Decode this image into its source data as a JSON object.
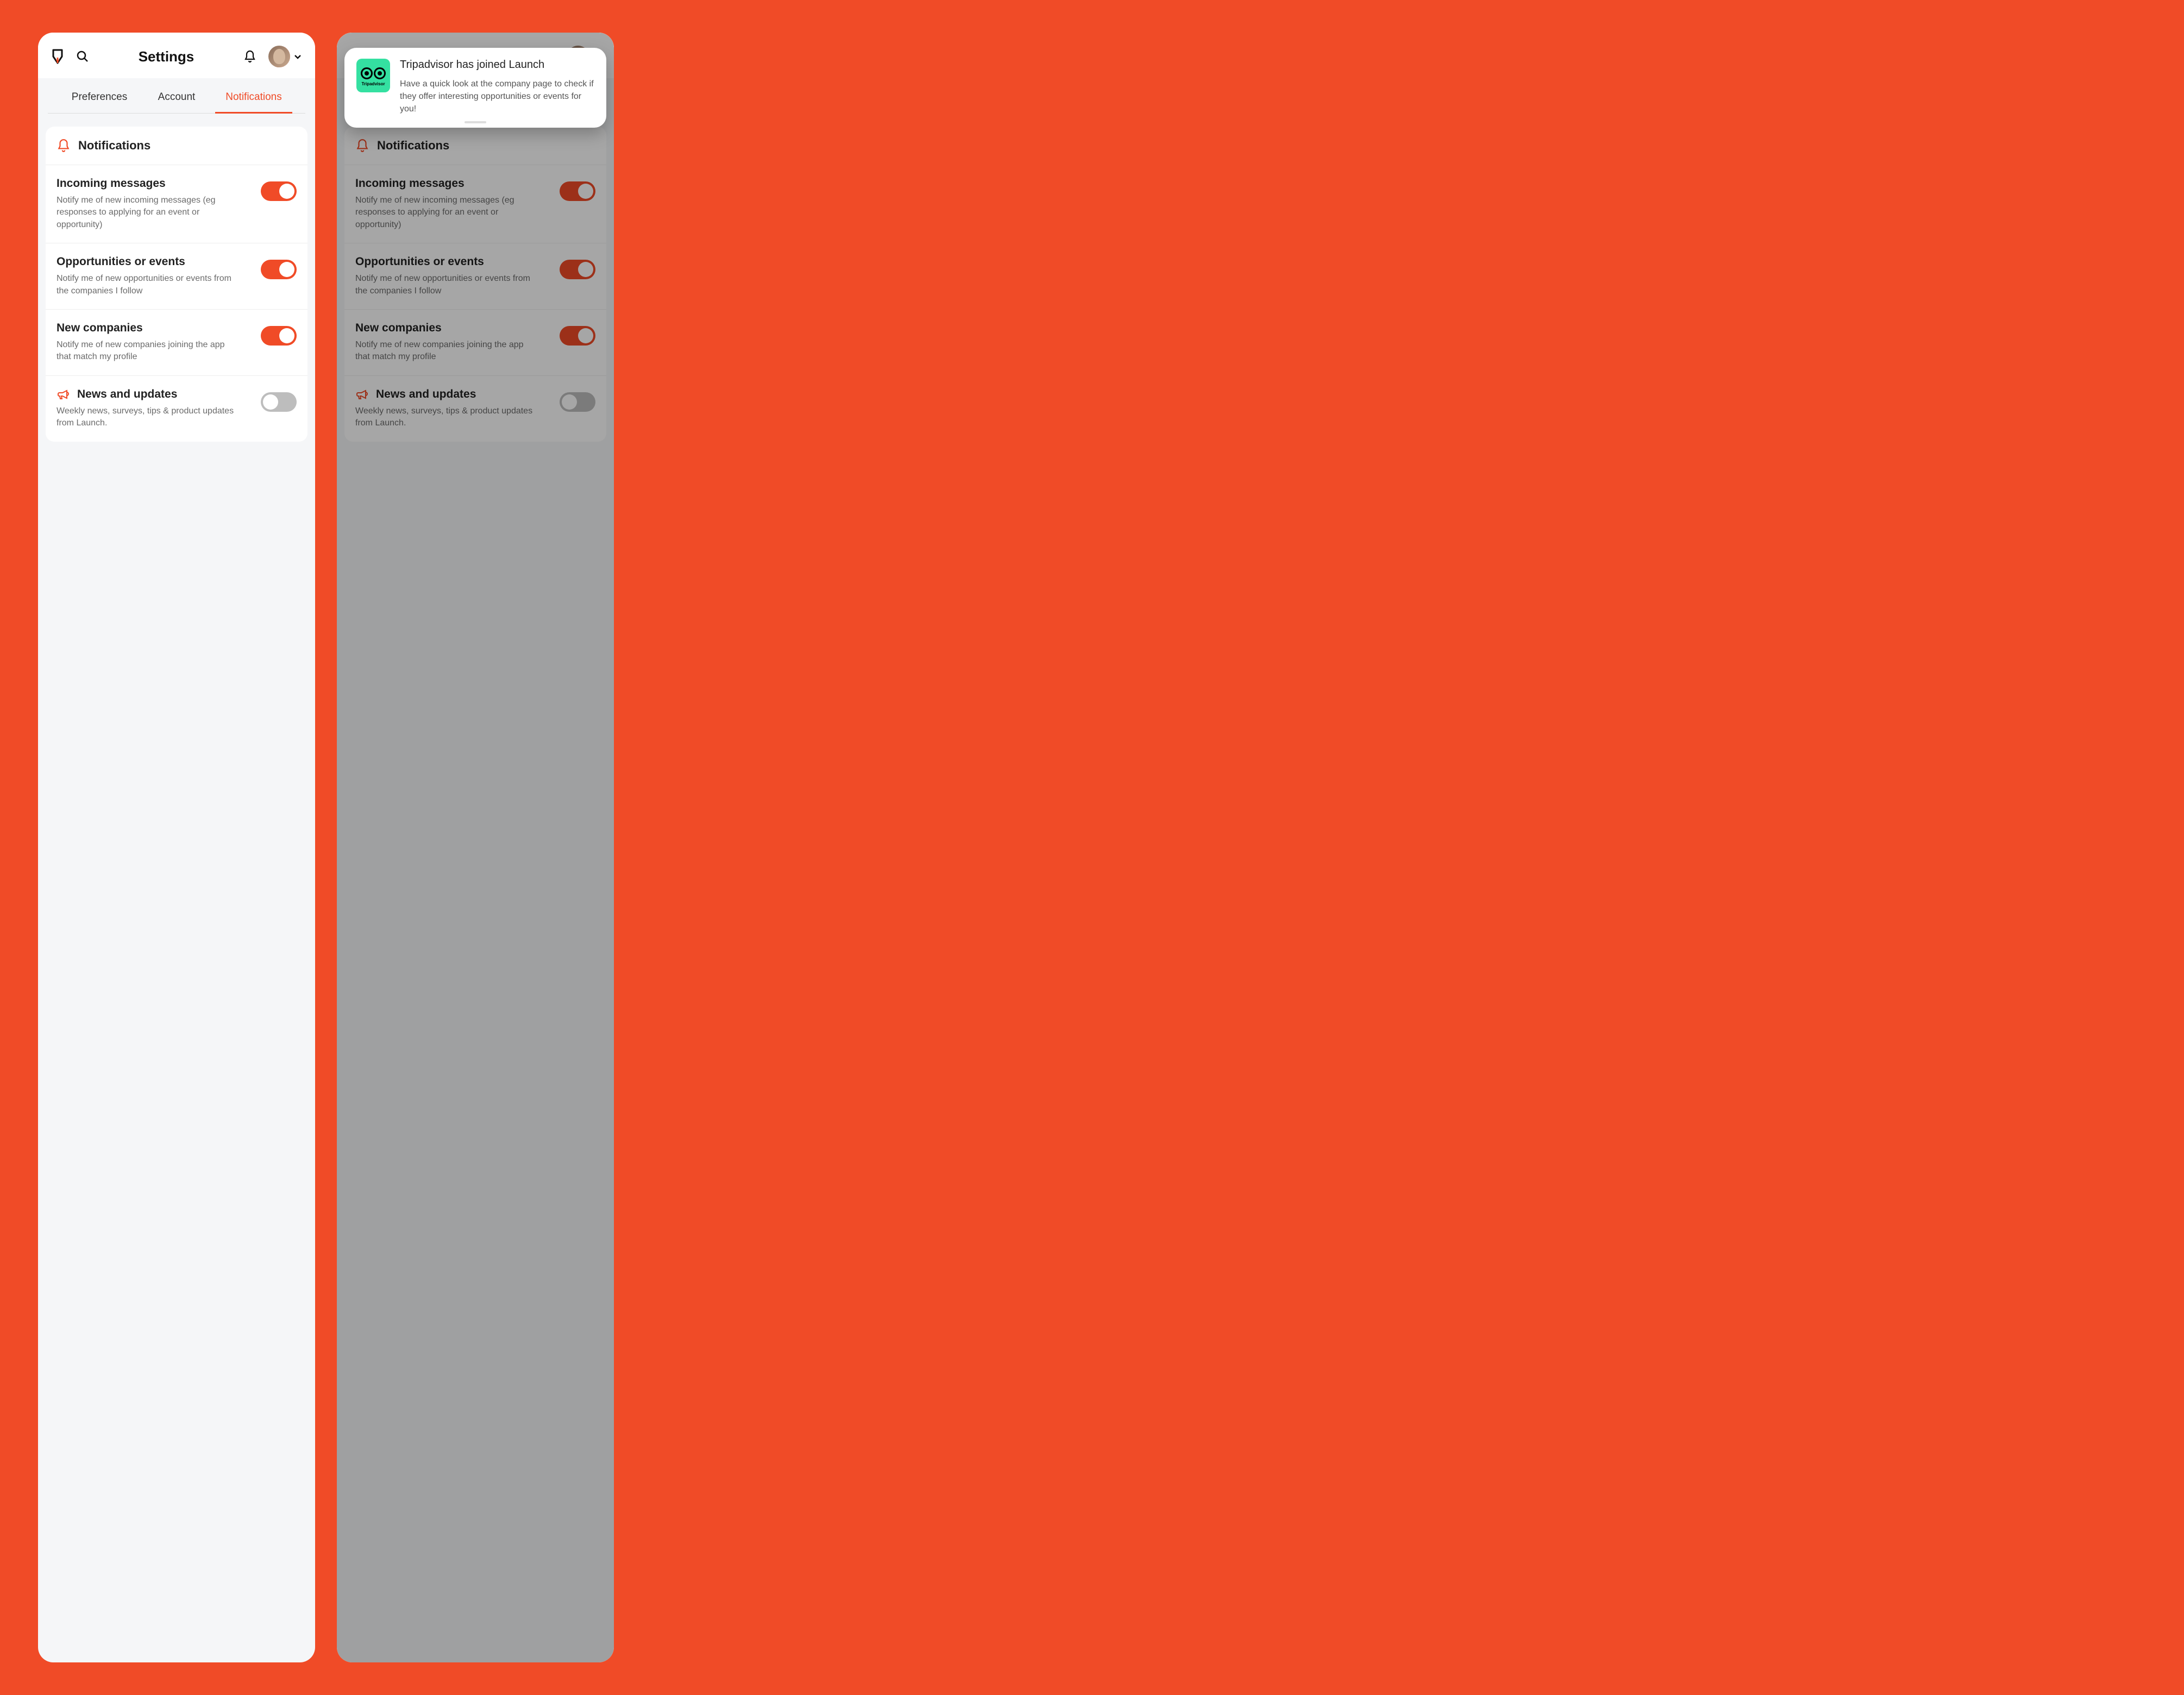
{
  "header": {
    "title": "Settings"
  },
  "tabs": [
    {
      "label": "Preferences",
      "active": false
    },
    {
      "label": "Account",
      "active": false
    },
    {
      "label": "Notifications",
      "active": true
    }
  ],
  "card": {
    "title": "Notifications"
  },
  "rows": [
    {
      "title": "Incoming messages",
      "desc": "Notify me of new incoming messages (eg responses to applying for an event or opportunity)",
      "on": true,
      "icon": null
    },
    {
      "title": "Opportunities or events",
      "desc": "Notify me of new opportunities or events from the companies I follow",
      "on": true,
      "icon": null
    },
    {
      "title": "New companies",
      "desc": "Notify me of new companies joining the app that match my profile",
      "on": true,
      "icon": null
    },
    {
      "title": "News and updates",
      "desc": "Weekly news, surveys, tips & product updates from Launch.",
      "on": false,
      "icon": "megaphone"
    }
  ],
  "toast": {
    "brand": "Tripadvisor",
    "title": "Tripadvisor has joined Launch",
    "desc": "Have a quick look at the company page to check if they offer interesting opportunities or events for you!"
  },
  "colors": {
    "accent": "#f04b27",
    "toast_icon_bg": "#34e0a1"
  }
}
